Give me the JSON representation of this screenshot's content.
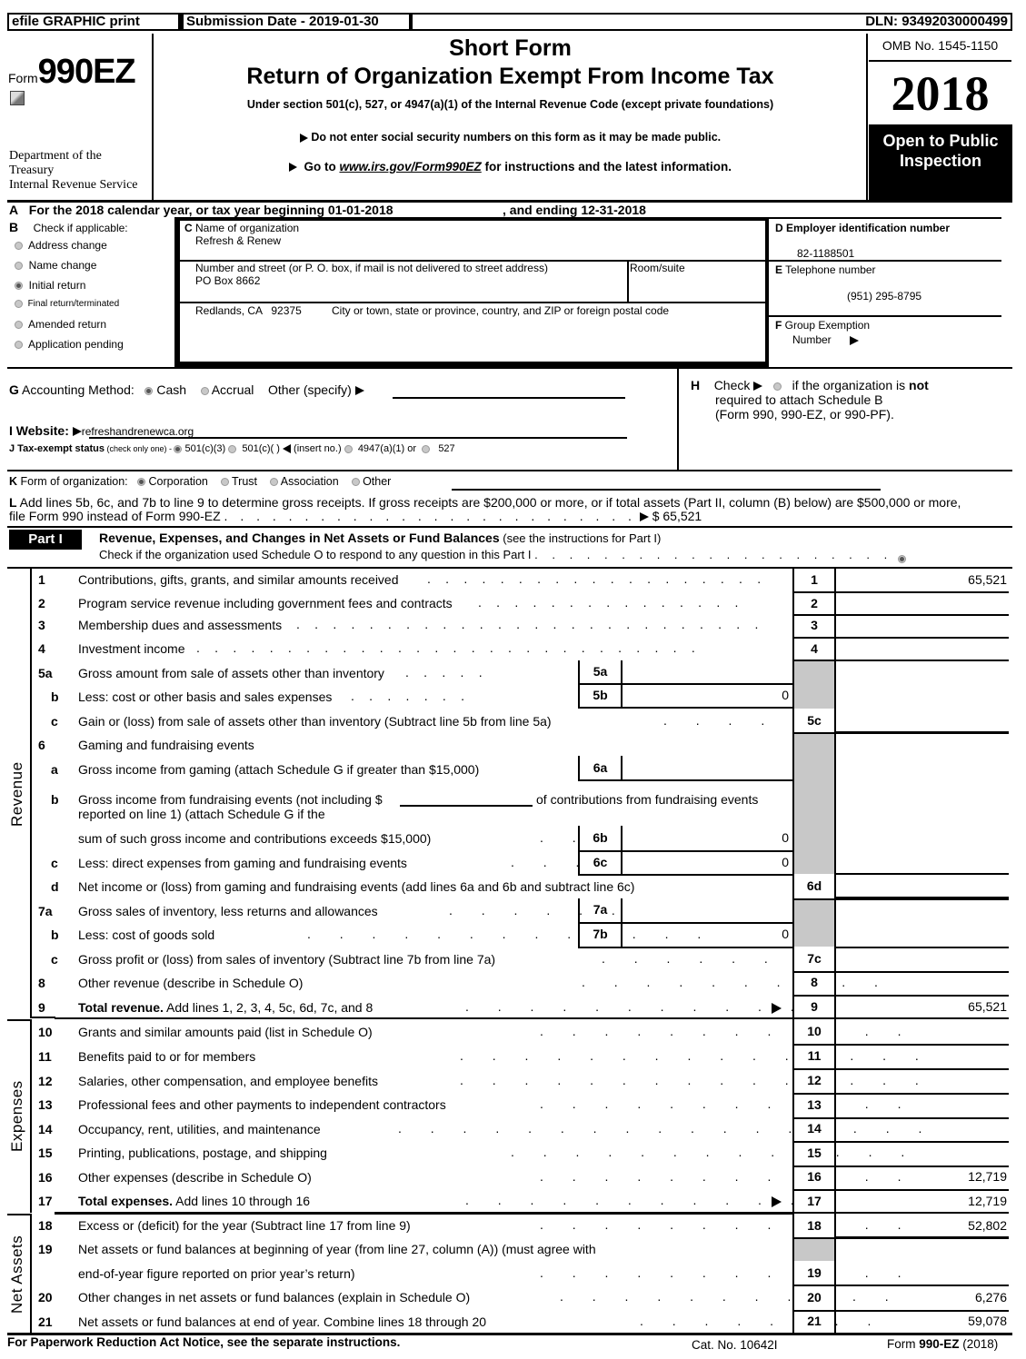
{
  "topbar": {
    "efile": "efile GRAPHIC print",
    "submission": "Submission Date - 2019-01-30",
    "dln": "DLN: 93492030000499"
  },
  "header": {
    "form_prefix": "Form",
    "form_number": "990EZ",
    "dept1": "Department of the",
    "dept2": "Treasury",
    "dept3": "Internal Revenue Service",
    "title1": "Short Form",
    "title2": "Return of Organization Exempt From Income Tax",
    "subtitle": "Under section 501(c), 527, or 4947(a)(1) of the Internal Revenue Code (except private foundations)",
    "notice": "Do not enter social security numbers on this form as it may be made public.",
    "goto_pre": "Go to ",
    "goto_link": "www.irs.gov/Form990EZ",
    "goto_post": " for instructions and the latest information.",
    "omb": "OMB No. 1545-1150",
    "year": "2018",
    "open1": "Open to Public",
    "open2": "Inspection"
  },
  "lineA": {
    "letter": "A",
    "text": "For the 2018 calendar year, or tax year beginning 01-01-2018",
    "ending": ", and ending 12-31-2018"
  },
  "sectionB": {
    "letter": "B",
    "label": "Check if applicable:",
    "items": [
      {
        "label": "Address change",
        "checked": false
      },
      {
        "label": "Name change",
        "checked": false
      },
      {
        "label": "Initial return",
        "checked": true
      },
      {
        "label": "Final return/terminated",
        "checked": false
      },
      {
        "label": "Amended return",
        "checked": false
      },
      {
        "label": "Application pending",
        "checked": false
      }
    ]
  },
  "sectionC": {
    "name_label_letter": "C",
    "name_label": " Name of organization",
    "name": "Refresh & Renew",
    "street_label": "Number and street (or P. O. box, if mail is not delivered to street address)",
    "street": "PO Box 8662",
    "room_label": "Room/suite",
    "city": "Redlands, CA   92375",
    "city_label": "City or town, state or province, country, and ZIP or foreign postal code"
  },
  "sectionD": {
    "letter": "D",
    "label": " Employer identification number",
    "value": "82-1188501"
  },
  "sectionE": {
    "letter": "E",
    "label": " Telephone number",
    "value": "(951) 295-8795"
  },
  "sectionF": {
    "letter": "F",
    "label": " Group Exemption",
    "label2": "Number"
  },
  "sectionG": {
    "letter": "G",
    "label": " Accounting Method:",
    "cash": "Cash",
    "accrual": "Accrual",
    "other": "Other (specify)"
  },
  "sectionH": {
    "letter": "H",
    "check": "Check",
    "text1": "if the organization is ",
    "text1b": "not",
    "text2": "required to attach Schedule B",
    "text3": "(Form 990, 990-EZ, or 990-PF)."
  },
  "sectionI": {
    "label": "I Website: ",
    "value": "refreshandrenewca.org"
  },
  "sectionJ": {
    "label": "J Tax-exempt status",
    "note": " (check only one) - ",
    "opt1": "501(c)(3)",
    "opt2": "501(c)(   )",
    "insert": "(insert no.)",
    "opt3": "4947(a)(1) or",
    "opt4": "527"
  },
  "sectionK": {
    "letter": "K",
    "label": " Form of organization:",
    "opts": [
      "Corporation",
      "Trust",
      "Association",
      "Other"
    ]
  },
  "sectionL": {
    "letter": "L",
    "text1": " Add lines 5b, 6c, and 7b to line 9 to determine gross receipts. If gross receipts are $200,000 or more, or if total assets (Part II, column (B) below) are $500,000 or more,",
    "text2": "file Form 990 instead of Form 990-EZ",
    "amount": "$ 65,521"
  },
  "part1": {
    "tag": "Part I",
    "title": "Revenue, Expenses, and Changes in Net Assets or Fund Balances",
    "title_note": " (see the instructions for Part I)",
    "schedule_o": "Check if the organization used Schedule O to respond to any question in this Part I"
  },
  "side_labels": {
    "revenue": "Revenue",
    "expenses": "Expenses",
    "net_assets": "Net Assets"
  },
  "lines": {
    "l1": {
      "num": "1",
      "label": "Contributions, gifts, grants, and similar amounts received",
      "box": "1",
      "value": "65,521"
    },
    "l2": {
      "num": "2",
      "label": "Program service revenue including government fees and contracts",
      "box": "2",
      "value": ""
    },
    "l3": {
      "num": "3",
      "label": "Membership dues and assessments",
      "box": "3",
      "value": ""
    },
    "l4": {
      "num": "4",
      "label": "Investment income",
      "box": "4",
      "value": ""
    },
    "l5a": {
      "num": "5a",
      "label": "Gross amount from sale of assets other than inventory",
      "box": "5a",
      "value": ""
    },
    "l5b": {
      "num": "b",
      "label": "Less: cost or other basis and sales expenses",
      "box": "5b",
      "value": "0"
    },
    "l5c": {
      "num": "c",
      "label": "Gain or (loss) from sale of assets other than inventory (Subtract line 5b from line 5a)",
      "box": "5c",
      "value": ""
    },
    "l6": {
      "num": "6",
      "label": "Gaming and fundraising events"
    },
    "l6a": {
      "num": "a",
      "label": "Gross income from gaming (attach Schedule G if greater than $15,000)",
      "box": "6a",
      "value": ""
    },
    "l6b": {
      "num": "b",
      "label": "Gross income from fundraising events (not including $",
      "label_mid": "of contributions from fundraising events",
      "label2": "reported on line 1) (attach Schedule G if the",
      "label3": "sum of such gross income and contributions exceeds $15,000)",
      "box": "6b",
      "value": "0"
    },
    "l6c": {
      "num": "c",
      "label": "Less: direct expenses from gaming and fundraising events",
      "box": "6c",
      "value": "0"
    },
    "l6d": {
      "num": "d",
      "label": "Net income or (loss) from gaming and fundraising events (add lines 6a and 6b and subtract line 6c)",
      "box": "6d",
      "value": ""
    },
    "l7a": {
      "num": "7a",
      "label": "Gross sales of inventory, less returns and allowances",
      "box": "7a",
      "value": ""
    },
    "l7b": {
      "num": "b",
      "label": "Less: cost of goods sold",
      "box": "7b",
      "value": "0"
    },
    "l7c": {
      "num": "c",
      "label": "Gross profit or (loss) from sales of inventory (Subtract line 7b from line 7a)",
      "box": "7c",
      "value": ""
    },
    "l8": {
      "num": "8",
      "label": "Other revenue (describe in Schedule O)",
      "box": "8",
      "value": ""
    },
    "l9": {
      "num": "9",
      "label_b": "Total revenue.",
      "label": " Add lines 1, 2, 3, 4, 5c, 6d, 7c, and 8",
      "box": "9",
      "value": "65,521"
    },
    "l10": {
      "num": "10",
      "label": "Grants and similar amounts paid (list in Schedule O)",
      "box": "10",
      "value": ""
    },
    "l11": {
      "num": "11",
      "label": "Benefits paid to or for members",
      "box": "11",
      "value": ""
    },
    "l12": {
      "num": "12",
      "label": "Salaries, other compensation, and employee benefits",
      "box": "12",
      "value": ""
    },
    "l13": {
      "num": "13",
      "label": "Professional fees and other payments to independent contractors",
      "box": "13",
      "value": ""
    },
    "l14": {
      "num": "14",
      "label": "Occupancy, rent, utilities, and maintenance",
      "box": "14",
      "value": ""
    },
    "l15": {
      "num": "15",
      "label": "Printing, publications, postage, and shipping",
      "box": "15",
      "value": ""
    },
    "l16": {
      "num": "16",
      "label": "Other expenses (describe in Schedule O)",
      "box": "16",
      "value": "12,719"
    },
    "l17": {
      "num": "17",
      "label_b": "Total expenses.",
      "label": " Add lines 10 through 16",
      "box": "17",
      "value": "12,719"
    },
    "l18": {
      "num": "18",
      "label": "Excess or (deficit) for the year (Subtract line 17 from line 9)",
      "box": "18",
      "value": "52,802"
    },
    "l19": {
      "num": "19",
      "label": "Net assets or fund balances at beginning of year (from line 27, column (A)) (must agree with",
      "label2": "end-of-year figure reported on prior year’s return)",
      "box": "19",
      "value": ""
    },
    "l20": {
      "num": "20",
      "label": "Other changes in net assets or fund balances (explain in Schedule O)",
      "box": "20",
      "value": "6,276"
    },
    "l21": {
      "num": "21",
      "label": "Net assets or fund balances at end of year. Combine lines 18 through 20",
      "box": "21",
      "value": "59,078"
    }
  },
  "footer": {
    "left": "For Paperwork Reduction Act Notice, see the separate instructions.",
    "cat": "Cat. No. 10642I",
    "form_pre": "Form ",
    "form_b": "990-EZ",
    "form_post": " (2018)"
  }
}
